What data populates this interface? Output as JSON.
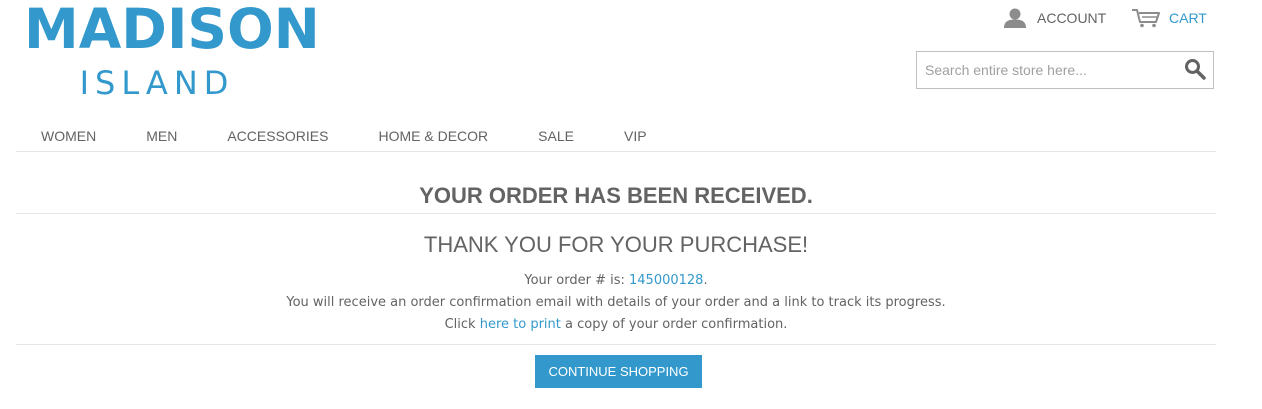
{
  "logo": {
    "line1": "MADISON",
    "line2": "ISLAND",
    "color": "#3399cc"
  },
  "header": {
    "account": {
      "label": "ACCOUNT",
      "icon": "user-icon"
    },
    "cart": {
      "label": "CART",
      "icon": "cart-icon"
    },
    "search": {
      "placeholder": "Search entire store here...",
      "value": "",
      "icon": "search-icon"
    }
  },
  "nav": {
    "items": [
      {
        "label": "WOMEN"
      },
      {
        "label": "MEN"
      },
      {
        "label": "ACCESSORIES"
      },
      {
        "label": "HOME & DECOR"
      },
      {
        "label": "SALE"
      },
      {
        "label": "VIP"
      }
    ]
  },
  "main": {
    "title": "YOUR ORDER HAS BEEN RECEIVED.",
    "subtitle": "THANK YOU FOR YOUR PURCHASE!",
    "order_prefix": "Your order # is: ",
    "order_number": "145000128",
    "order_suffix": ".",
    "email_notice": "You will receive an order confirmation email with details of your order and a link to track its progress.",
    "print_prefix": "Click ",
    "print_link": "here to print",
    "print_suffix": " a copy of your order confirmation.",
    "continue_label": "CONTINUE SHOPPING"
  },
  "colors": {
    "accent": "#3399cc",
    "text": "#636363",
    "divider": "#e6e6e6"
  }
}
